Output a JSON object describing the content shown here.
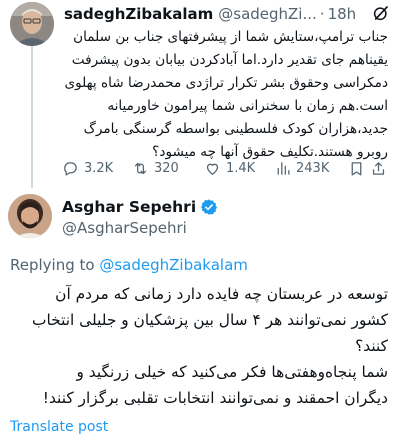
{
  "parent_tweet": {
    "display_name": "sadeghZibakalam",
    "handle": "@sadeghZi...",
    "separator": "·",
    "time": "18h",
    "text_lines": [
      "جناب ترامپ،ستایش شما از پیشرفتهای جناب بن سلمان",
      "یقیناهم جای تقدیر دارد.اما آبادکردن بیابان بدون پیشرفت",
      "دمکراسی وحقوق بشر تکرار تراژدی محمدرضا شاه پهلوی",
      "است.هم زمان با سخنرانی شما پیرامون خاورمیانه",
      "جدید،هزاران کودک فلسطینی بواسطه گرسنگی  بامرگ",
      "روبرو هستند.تکلیف حقوق آنها چه میشود؟"
    ],
    "stats": {
      "replies": "3.2K",
      "retweets": "320",
      "likes": "1.4K",
      "views": "243K"
    }
  },
  "main_tweet": {
    "display_name": "Asghar Sepehri",
    "handle": "@AsgharSepehri",
    "replying_prefix": "Replying to",
    "replying_mention": "@sadeghZibakalam",
    "text_lines": [
      "توسعه در عربستان چه فایده دارد زمانی که مردم آن",
      "کشور نمی‌توانند هر ۴ سال بین پزشکیان و جلیلی انتخاب",
      "کنند؟",
      "شما پنجاه‌وهفتی‌ها فکر می‌کنید که خیلی زرنگید و",
      "دیگران احمقند و نمی‌توانند انتخابات تقلبی برگزار کنند!"
    ],
    "translate_label": "Translate post"
  },
  "colors": {
    "link_blue": "#1d9bf0",
    "secondary_text": "#536471",
    "verified_badge": "#1d9bf0",
    "thread_line": "#cfd9de"
  },
  "icons": [
    "grok-icon",
    "reply-icon",
    "retweet-icon",
    "like-icon",
    "views-icon",
    "bookmark-icon",
    "share-icon",
    "verified-badge-icon"
  ]
}
